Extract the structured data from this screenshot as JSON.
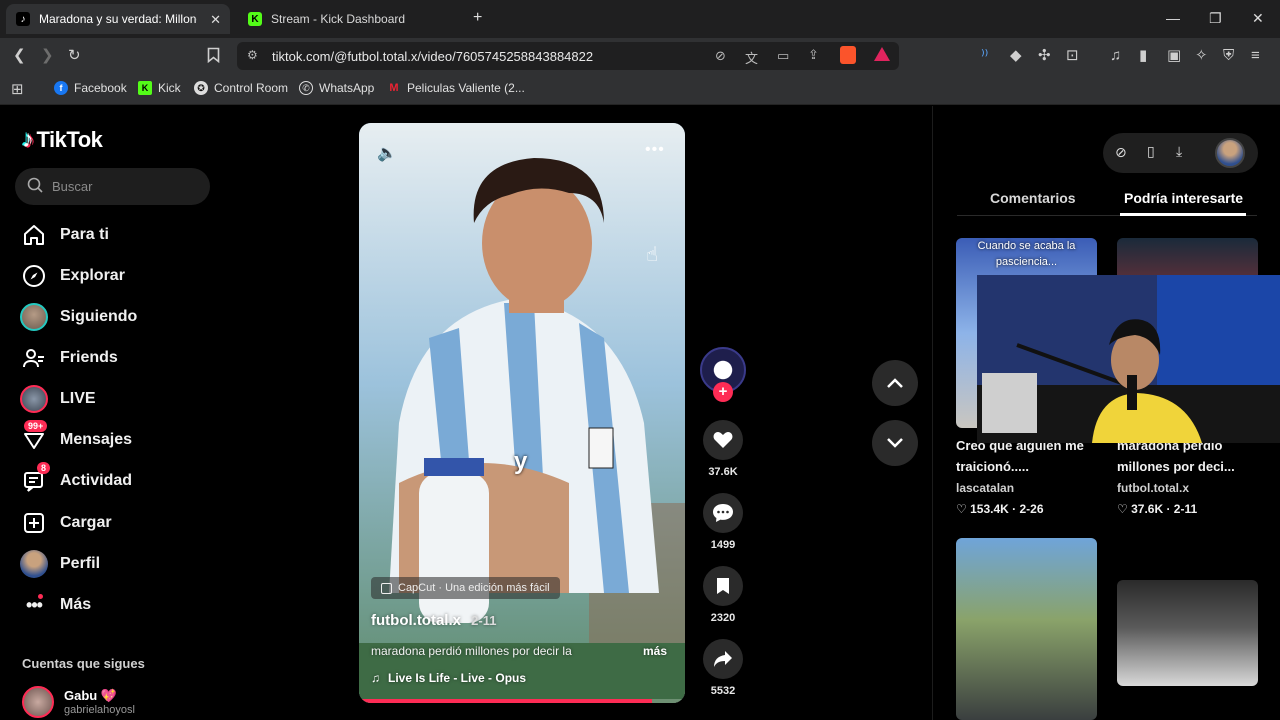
{
  "tabs": [
    {
      "title": "Maradona y su verdad: Millones",
      "active": true
    },
    {
      "title": "Stream - Kick Dashboard",
      "active": false
    }
  ],
  "url": "tiktok.com/@futbol.total.x/video/7605745258843884822",
  "bookmarks": [
    "Facebook",
    "Kick",
    "Control Room",
    "WhatsApp",
    "Peliculas Valiente (2..."
  ],
  "tiktok": {
    "logo": "TikTok",
    "search_placeholder": "Buscar",
    "nav": [
      {
        "label": "Para ti",
        "icon": "home-icon"
      },
      {
        "label": "Explorar",
        "icon": "compass-icon"
      },
      {
        "label": "Siguiendo",
        "icon": "avatar"
      },
      {
        "label": "Friends",
        "icon": "friends-icon"
      },
      {
        "label": "LIVE",
        "icon": "live-avatar"
      },
      {
        "label": "Mensajes",
        "icon": "message-icon",
        "badge": "99+"
      },
      {
        "label": "Actividad",
        "icon": "activity-icon",
        "badge": "8"
      },
      {
        "label": "Cargar",
        "icon": "upload-icon"
      },
      {
        "label": "Perfil",
        "icon": "profile-avatar"
      },
      {
        "label": "Más",
        "icon": "more-icon"
      }
    ],
    "following_title": "Cuentas que sigues",
    "following": [
      {
        "name": "Gabu 💖",
        "handle": "gabrielahoyosl"
      }
    ]
  },
  "video": {
    "caption_overlay": "y",
    "capcut": "CapCut · Una edición más fácil",
    "author": "futbol.total.x",
    "date": "2-11",
    "description": "maradona perdió millones por decir la",
    "more": "más",
    "music": "Live Is Life - Live - Opus",
    "progress": 0.9
  },
  "actions": {
    "likes": "37.6K",
    "comments": "1499",
    "saves": "2320",
    "shares": "5532"
  },
  "right": {
    "tab_comments": "Comentarios",
    "tab_suggested": "Podría interesarte",
    "cards": [
      {
        "overlay": "Cuando se acaba la pasciencia...",
        "title": "Creo que alguien me traicionó.....",
        "author": "lascatalan",
        "likes": "153.4K",
        "date": "2-26"
      },
      {
        "title": "maradona perdió millones por deci...",
        "author": "futbol.total.x",
        "likes": "37.6K",
        "date": "2-11"
      }
    ]
  }
}
